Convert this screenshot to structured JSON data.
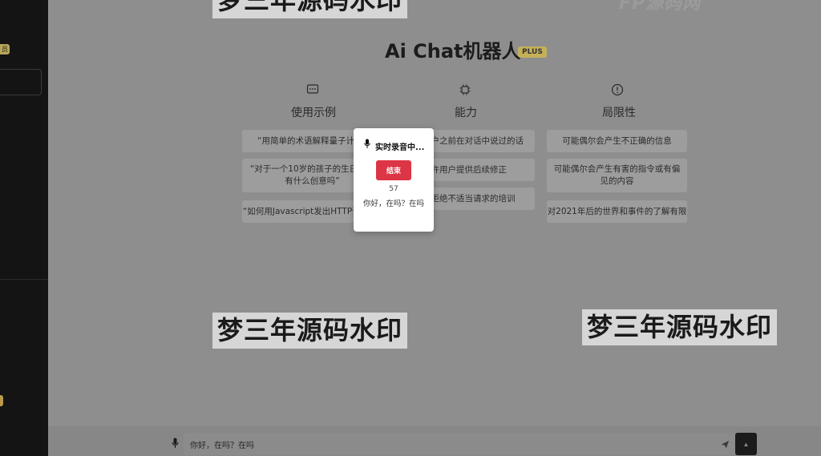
{
  "watermark": "梦三年源码水印",
  "header": {
    "title": "Ai Chat机器人",
    "badge": "PLUS"
  },
  "columns": [
    {
      "icon": "chat-bubble-icon",
      "heading": "使用示例",
      "items": [
        "“用简单的术语解释量子计算”",
        "“对于一个10岁的孩子的生日，你有什么创意吗”",
        "“如何用Javascript发出HTTP请求？”"
      ]
    },
    {
      "icon": "chip-icon",
      "heading": "能力",
      "items": [
        "记住用户之前在对话中说过的话",
        "允许用户提供后续修正",
        "受过拒绝不适当请求的培训"
      ]
    },
    {
      "icon": "warning-circle-icon",
      "heading": "局限性",
      "items": [
        "可能偶尔会产生不正确的信息",
        "可能偶尔会产生有害的指令或有偏见的内容",
        "对2021年后的世界和事件的了解有限"
      ]
    }
  ],
  "recording_modal": {
    "title": "实时录音中...",
    "end_button": "结束",
    "counter": "57",
    "transcript": "你好，在吗？在吗"
  },
  "composer": {
    "input_value": "你好，在吗？在吗"
  },
  "colors": {
    "end_button": "#dc3545",
    "plus_badge": "#c5b05a"
  }
}
